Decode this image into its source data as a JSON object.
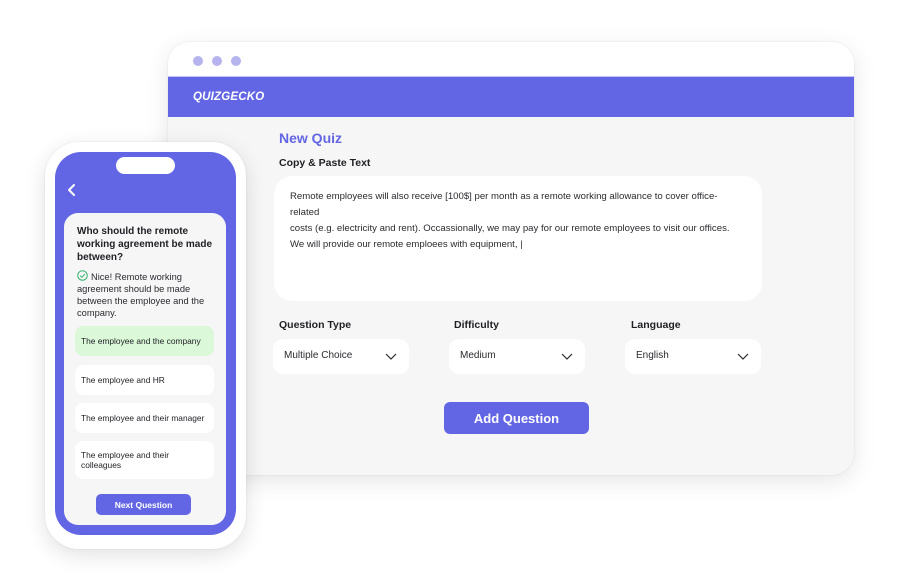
{
  "colors": {
    "brand": "#6366e4",
    "correct": "#dbf8d8",
    "window_dots": "#b5b4ee"
  },
  "browser": {
    "logo": "QUIZGECKO",
    "page_title": "New Quiz",
    "paste_label": "Copy & Paste Text",
    "paste_text": [
      "Remote employees will also receive [100$] per month as a remote working allowance to cover office-related",
      "costs (e.g. electricity and rent). Occassionally, we may pay for our remote employees to visit our offices.",
      "We will provide our remote emploees with equipment, |"
    ],
    "question_type": {
      "label": "Question Type",
      "value": "Multiple Choice"
    },
    "difficulty": {
      "label": "Difficulty",
      "value": "Medium"
    },
    "language": {
      "label": "Language",
      "value": "English"
    },
    "add_button": "Add Question"
  },
  "phone": {
    "question": "Who should the remote working agreement be made between?",
    "feedback": "Nice! Remote working agreement should be made between the employee and the company.",
    "options": [
      {
        "label": "The employee and the company",
        "correct": true
      },
      {
        "label": "The employee and HR",
        "correct": false
      },
      {
        "label": "The employee and their manager",
        "correct": false
      },
      {
        "label": "The employee and their colleagues",
        "correct": false
      }
    ],
    "next_button": "Next Question"
  }
}
